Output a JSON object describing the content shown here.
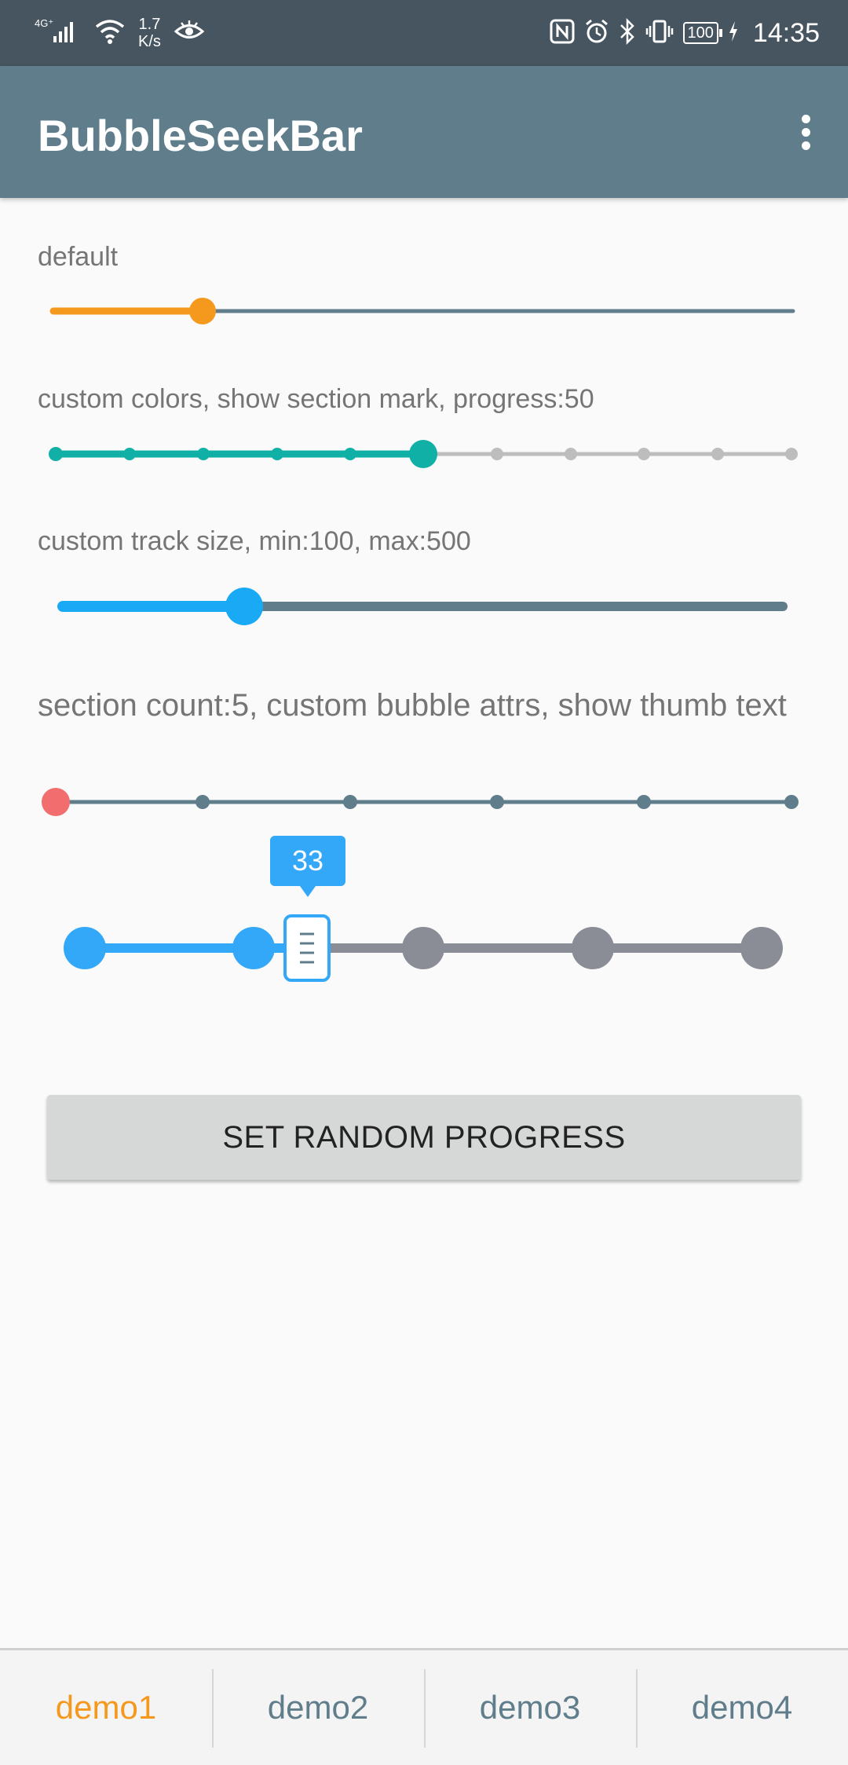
{
  "status_bar": {
    "network_type": "4G⁺",
    "speed_value": "1.7",
    "speed_unit": "K/s",
    "battery": "100",
    "time": "14:35"
  },
  "app_bar": {
    "title": "BubbleSeekBar",
    "overflow_icon": "more-vert-icon"
  },
  "seekbars": [
    {
      "label": "default",
      "progress_fraction": 0.2,
      "colors": {
        "active": "#f5991e",
        "track": "#607d8b"
      }
    },
    {
      "label": "custom colors, show section mark, progress:50",
      "progress": 50,
      "section_count": 10,
      "colors": {
        "active": "#11b0a6",
        "track": "#bdbdbd"
      }
    },
    {
      "label": "custom track size, min:100, max:500",
      "min": 100,
      "max": 500,
      "progress_fraction": 0.25,
      "colors": {
        "active": "#1aaaf5",
        "track": "#607d8b"
      }
    },
    {
      "label": "section count:5, custom bubble attrs, show thumb text",
      "section_count": 5,
      "progress_fraction": 0,
      "colors": {
        "thumb": "#f26d6d",
        "track": "#607d8b"
      }
    },
    {
      "bubble_text": "33",
      "progress_fraction": 0.33,
      "colors": {
        "active": "#34a8f8",
        "track": "#8a8d95",
        "bubble": "#34a8f8"
      }
    }
  ],
  "random_button": {
    "label": "SET RANDOM PROGRESS"
  },
  "bottom_nav": {
    "items": [
      "demo1",
      "demo2",
      "demo3",
      "demo4"
    ],
    "active_index": 0,
    "active_color": "#f5991e",
    "inactive_color": "#607d8b"
  }
}
